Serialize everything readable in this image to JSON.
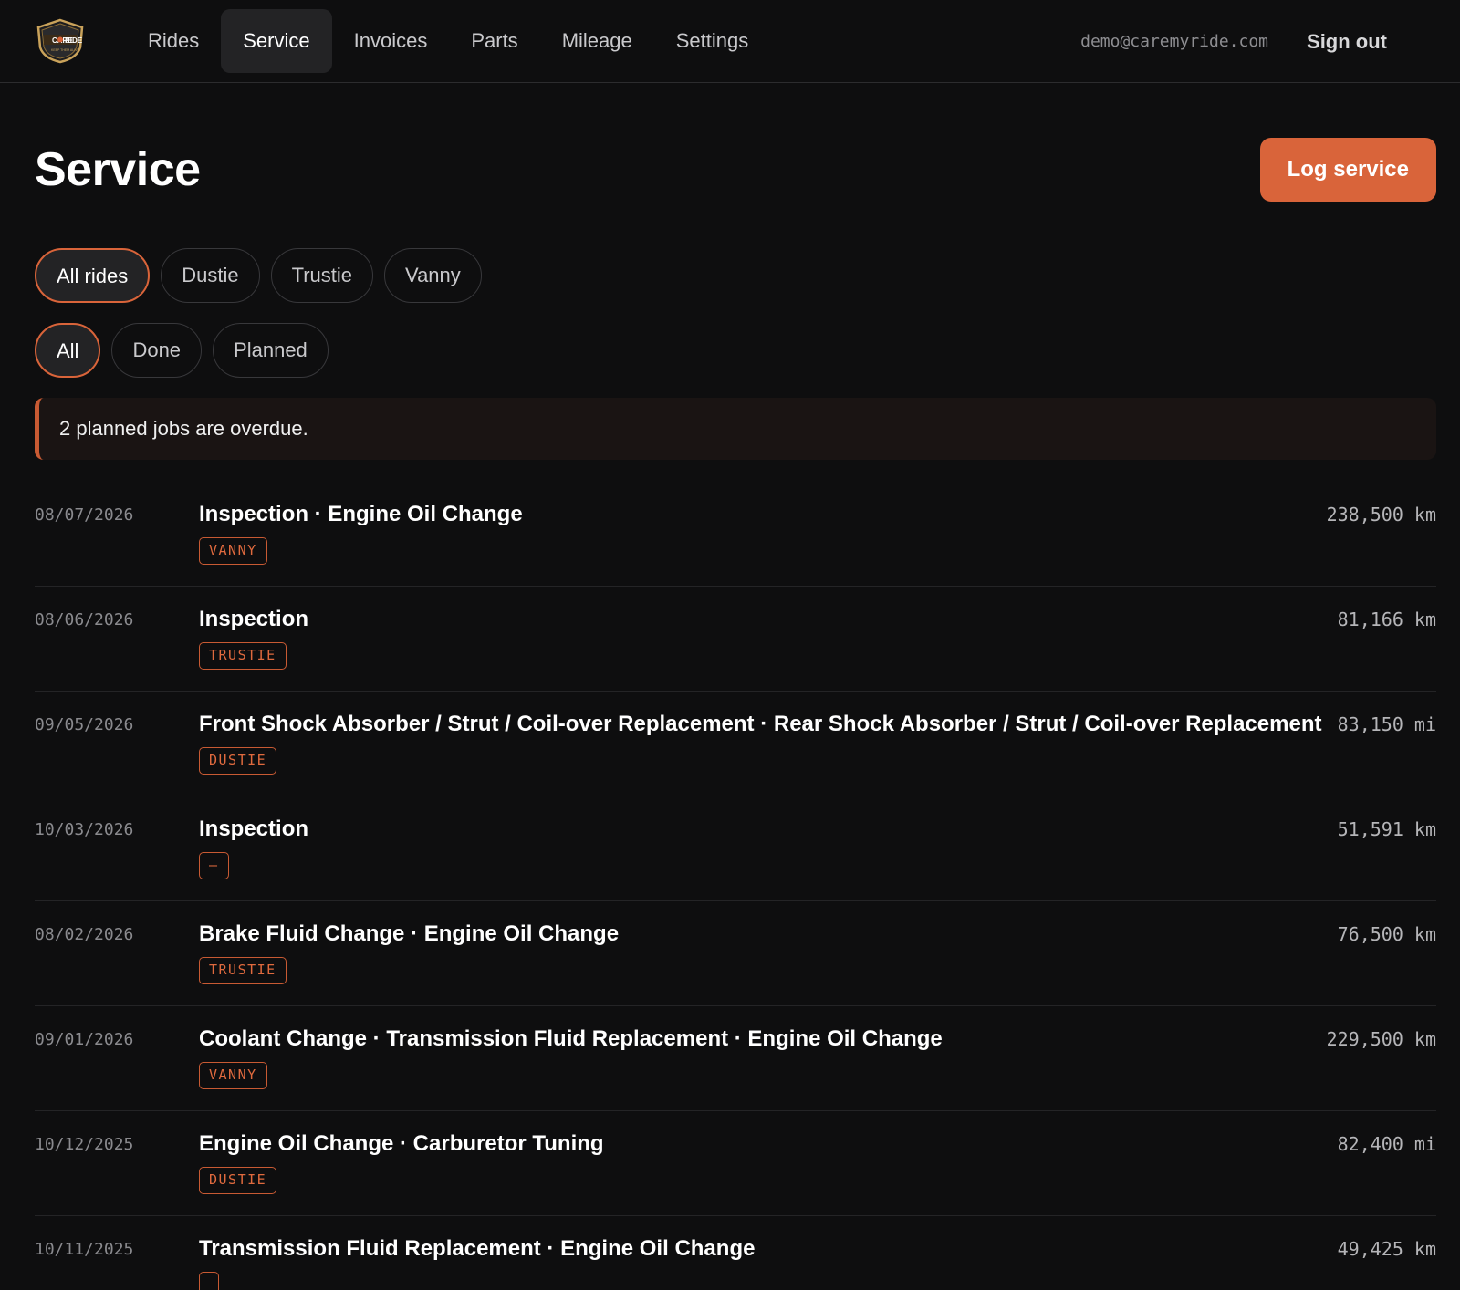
{
  "brand": {
    "logo_text": "CARE",
    "logo_text2": "RIDE",
    "logo_sub": "KEEP THEM ALIVE"
  },
  "nav": {
    "items": [
      {
        "label": "Rides",
        "active": false
      },
      {
        "label": "Service",
        "active": true
      },
      {
        "label": "Invoices",
        "active": false
      },
      {
        "label": "Parts",
        "active": false
      },
      {
        "label": "Mileage",
        "active": false
      },
      {
        "label": "Settings",
        "active": false
      }
    ]
  },
  "user": {
    "email": "demo@caremyride.com",
    "signout_label": "Sign out"
  },
  "page": {
    "title": "Service",
    "log_button": "Log service"
  },
  "filters": {
    "rides": [
      {
        "label": "All rides",
        "active": true
      },
      {
        "label": "Dustie",
        "active": false
      },
      {
        "label": "Trustie",
        "active": false
      },
      {
        "label": "Vanny",
        "active": false
      }
    ],
    "status": [
      {
        "label": "All",
        "active": true
      },
      {
        "label": "Done",
        "active": false
      },
      {
        "label": "Planned",
        "active": false
      }
    ]
  },
  "alert": {
    "text": "2 planned jobs are overdue."
  },
  "services": [
    {
      "date": "08/07/2026",
      "title": "Inspection · Engine Oil Change",
      "ride": "VANNY",
      "odometer": "238,500 km"
    },
    {
      "date": "08/06/2026",
      "title": "Inspection",
      "ride": "TRUSTIE",
      "odometer": "81,166 km"
    },
    {
      "date": "09/05/2026",
      "title": "Front Shock Absorber / Strut / Coil-over Replacement · Rear Shock Absorber / Strut / Coil-over Replacement",
      "ride": "DUSTIE",
      "odometer": "83,150 mi"
    },
    {
      "date": "10/03/2026",
      "title": "Inspection",
      "ride": "—",
      "odometer": "51,591 km"
    },
    {
      "date": "08/02/2026",
      "title": "Brake Fluid Change · Engine Oil Change",
      "ride": "TRUSTIE",
      "odometer": "76,500 km"
    },
    {
      "date": "09/01/2026",
      "title": "Coolant Change · Transmission Fluid Replacement · Engine Oil Change",
      "ride": "VANNY",
      "odometer": "229,500 km"
    },
    {
      "date": "10/12/2025",
      "title": "Engine Oil Change · Carburetor Tuning",
      "ride": "DUSTIE",
      "odometer": "82,400 mi"
    },
    {
      "date": "10/11/2025",
      "title": "Transmission Fluid Replacement · Engine Oil Change",
      "ride": "",
      "odometer": "49,425 km"
    }
  ],
  "colors": {
    "accent": "#d9643a",
    "background": "#0e0e0f",
    "alert_bg": "#1a1413"
  }
}
